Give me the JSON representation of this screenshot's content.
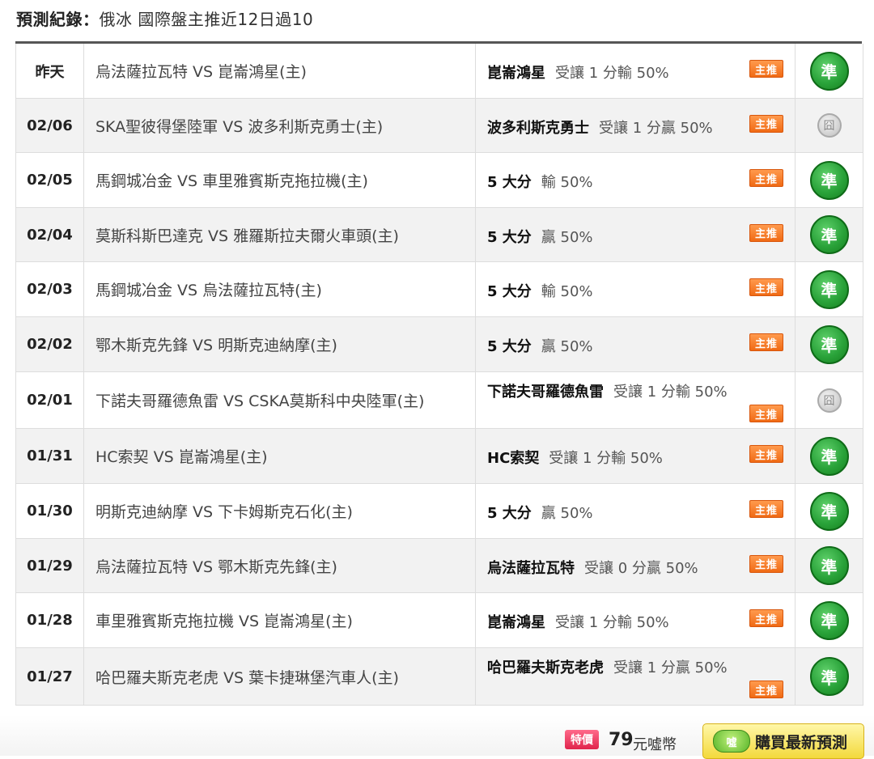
{
  "header": {
    "label": "預測紀錄：",
    "subtitle": "俄冰 國際盤主推近12日過10"
  },
  "badges": {
    "main_pick": "主推",
    "hit": "準",
    "push": "囧"
  },
  "rows": [
    {
      "date": "昨天",
      "match": "烏法薩拉瓦特 VS 崑崙鴻星(主)",
      "team": "崑崙鴻星",
      "detail": "受讓 1 分輸 50%",
      "wrap": false,
      "result": "hit"
    },
    {
      "date": "02/06",
      "match": "SKA聖彼得堡陸軍 VS 波多利斯克勇士(主)",
      "team": "波多利斯克勇士",
      "detail": "受讓 1 分贏 50%",
      "wrap": false,
      "result": "push"
    },
    {
      "date": "02/05",
      "match": "馬鋼城冶金 VS 車里雅賓斯克拖拉機(主)",
      "team": "5 大分",
      "detail": "輸 50%",
      "wrap": false,
      "result": "hit"
    },
    {
      "date": "02/04",
      "match": "莫斯科斯巴達克 VS 雅羅斯拉夫爾火車頭(主)",
      "team": "5 大分",
      "detail": "贏 50%",
      "wrap": false,
      "result": "hit"
    },
    {
      "date": "02/03",
      "match": "馬鋼城冶金 VS 烏法薩拉瓦特(主)",
      "team": "5 大分",
      "detail": "輸 50%",
      "wrap": false,
      "result": "hit"
    },
    {
      "date": "02/02",
      "match": "鄂木斯克先鋒 VS 明斯克迪納摩(主)",
      "team": "5 大分",
      "detail": "贏 50%",
      "wrap": false,
      "result": "hit"
    },
    {
      "date": "02/01",
      "match": "下諾夫哥羅德魚雷 VS CSKA莫斯科中央陸軍(主)",
      "team": "下諾夫哥羅德魚雷",
      "detail": "受讓 1 分輸 50%",
      "wrap": true,
      "result": "push"
    },
    {
      "date": "01/31",
      "match": "HC索契 VS 崑崙鴻星(主)",
      "team": "HC索契",
      "detail": "受讓 1 分輸 50%",
      "wrap": false,
      "result": "hit"
    },
    {
      "date": "01/30",
      "match": "明斯克迪納摩 VS 下卡姆斯克石化(主)",
      "team": "5 大分",
      "detail": "贏 50%",
      "wrap": false,
      "result": "hit"
    },
    {
      "date": "01/29",
      "match": "烏法薩拉瓦特 VS 鄂木斯克先鋒(主)",
      "team": "烏法薩拉瓦特",
      "detail": "受讓 0 分贏 50%",
      "wrap": false,
      "result": "hit"
    },
    {
      "date": "01/28",
      "match": "車里雅賓斯克拖拉機 VS 崑崙鴻星(主)",
      "team": "崑崙鴻星",
      "detail": "受讓 1 分輸 50%",
      "wrap": false,
      "result": "hit"
    },
    {
      "date": "01/27",
      "match": "哈巴羅夫斯克老虎 VS 葉卡捷琳堡汽車人(主)",
      "team": "哈巴羅夫斯克老虎",
      "detail": "受讓 1 分贏 50%",
      "wrap": true,
      "result": "hit"
    }
  ],
  "footer": {
    "sale_badge": "特價",
    "price": "79",
    "unit": "元噓幣",
    "coin_label": "噓",
    "buy_label": "購買最新預測"
  }
}
